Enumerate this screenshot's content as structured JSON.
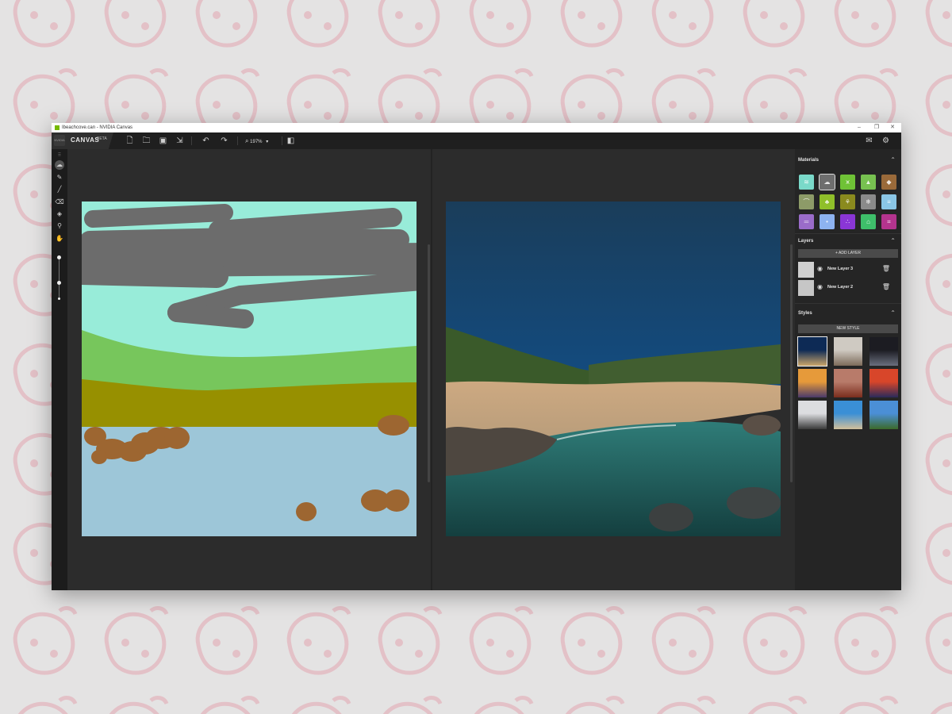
{
  "window": {
    "title": "Ibeachcove.can - NVIDIA Canvas",
    "min_icon": "–",
    "max_icon": "❐",
    "close_icon": "✕"
  },
  "toolbar": {
    "logo_text": "NVIDIA",
    "brand": "CANVAS",
    "brand_sup": "BETA",
    "zoom": "197%"
  },
  "materials": {
    "title": "Materials",
    "swatches": [
      {
        "name": "sea",
        "color": "#7ad9c9",
        "icon": "≋"
      },
      {
        "name": "cloud",
        "color": "#6e6e6e",
        "icon": "☁",
        "selected": true
      },
      {
        "name": "grass",
        "color": "#6fc236",
        "icon": "⩙"
      },
      {
        "name": "mountain-green",
        "color": "#77c150",
        "icon": "▲"
      },
      {
        "name": "rock",
        "color": "#9a6a3a",
        "icon": "◆"
      },
      {
        "name": "hill",
        "color": "#8d9b68",
        "icon": "⌒"
      },
      {
        "name": "tree",
        "color": "#8fbf2a",
        "icon": "♣"
      },
      {
        "name": "palm",
        "color": "#8a8a1e",
        "icon": "⚘"
      },
      {
        "name": "snow",
        "color": "#8a8a8a",
        "icon": "❄"
      },
      {
        "name": "water",
        "color": "#8ac6e6",
        "icon": "≡"
      },
      {
        "name": "road",
        "color": "#9a6cc9",
        "icon": "═"
      },
      {
        "name": "sky",
        "color": "#8db3f0",
        "icon": "•"
      },
      {
        "name": "flowers",
        "color": "#8a36d6",
        "icon": "∴"
      },
      {
        "name": "house",
        "color": "#3ebf6a",
        "icon": "⌂"
      },
      {
        "name": "bridge",
        "color": "#b4348e",
        "icon": "⌗"
      }
    ]
  },
  "layers": {
    "title": "Layers",
    "add_label": "+ ADD LAYER",
    "items": [
      {
        "name": "New Layer 3"
      },
      {
        "name": "New Layer 2"
      }
    ]
  },
  "styles": {
    "title": "Styles",
    "new_label": "NEW STYLE",
    "thumbs": [
      {
        "name": "blue-hour-coast",
        "colors": [
          "#0d2a55",
          "#caa56a"
        ],
        "selected": true
      },
      {
        "name": "misty-peak",
        "colors": [
          "#cfcac2",
          "#7d6b5a"
        ]
      },
      {
        "name": "cave-arch",
        "colors": [
          "#1c1c22",
          "#6a6f7e"
        ]
      },
      {
        "name": "sunset-lake",
        "colors": [
          "#e69a3a",
          "#4a3a6a"
        ]
      },
      {
        "name": "red-canyon",
        "colors": [
          "#b87b6a",
          "#7a2d1d"
        ]
      },
      {
        "name": "sunset-sea",
        "colors": [
          "#d8462a",
          "#2a2a5a"
        ]
      },
      {
        "name": "snowy-forest",
        "colors": [
          "#dcdde0",
          "#3a3a3a"
        ]
      },
      {
        "name": "tropical-beach",
        "colors": [
          "#3a8fd6",
          "#d2c09a"
        ]
      },
      {
        "name": "alpine-lake",
        "colors": [
          "#4b8fd6",
          "#3c6a2a"
        ]
      }
    ]
  },
  "colors": {
    "sky": "#98ecd9",
    "cloud": "#6c6c6c",
    "grass": "#77c65c",
    "bush": "#979000",
    "water": "#9dc6d8",
    "rock": "#9d6631"
  }
}
